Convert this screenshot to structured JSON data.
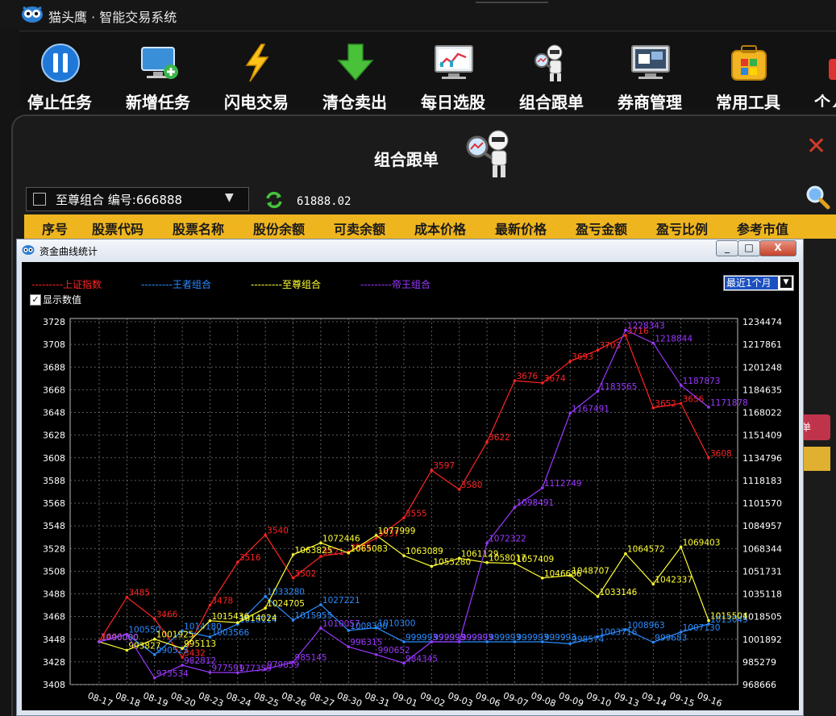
{
  "app": {
    "title": "猫头鹰 · 智能交易系统"
  },
  "toolbar": [
    {
      "label": "停止任务",
      "icon": "pause-icon"
    },
    {
      "label": "新增任务",
      "icon": "add-monitor-icon"
    },
    {
      "label": "闪电交易",
      "icon": "lightning-icon"
    },
    {
      "label": "清仓卖出",
      "icon": "download-arrow-icon"
    },
    {
      "label": "每日选股",
      "icon": "stock-chart-monitor-icon"
    },
    {
      "label": "组合跟单",
      "icon": "robot-magnifier-icon"
    },
    {
      "label": "券商管理",
      "icon": "broker-monitor-icon"
    },
    {
      "label": "常用工具",
      "icon": "toolbox-icon"
    },
    {
      "label": "个人",
      "icon": "user-icon"
    }
  ],
  "panel": {
    "title": "组合跟单",
    "portfolio_select": "至尊组合  编号:666888",
    "balance": "61888.02",
    "columns": [
      "序号",
      "股票代码",
      "股票名称",
      "股份余额",
      "可卖余额",
      "成本价格",
      "最新价格",
      "盈亏金额",
      "盈亏比例",
      "参考市值"
    ],
    "side_button_label": "单"
  },
  "dialog": {
    "title": "资金曲线统计",
    "minimize": "_",
    "maximize": "□",
    "close": "X",
    "period_select": "最近1个月",
    "show_values_label": "显示数值",
    "show_values_checked": true
  },
  "chart_data": {
    "type": "line",
    "categories": [
      "08-17",
      "08-18",
      "08-19",
      "08-20",
      "08-23",
      "08-24",
      "08-25",
      "08-26",
      "08-27",
      "08-30",
      "08-31",
      "09-01",
      "09-02",
      "09-03",
      "09-06",
      "09-07",
      "09-08",
      "09-09",
      "09-10",
      "09-13",
      "09-14",
      "09-15",
      "09-16"
    ],
    "left_ylim": [
      3408,
      3728
    ],
    "left_ticks": [
      3728,
      3708,
      3688,
      3668,
      3648,
      3628,
      3608,
      3588,
      3568,
      3548,
      3528,
      3508,
      3488,
      3468,
      3448,
      3428,
      3408
    ],
    "right_ylim": [
      968666,
      1234474
    ],
    "right_ticks": [
      1234474,
      1217861,
      1201248,
      1184635,
      1168022,
      1151409,
      1134796,
      1118183,
      1101570,
      1084957,
      1068344,
      1051731,
      1035118,
      1018505,
      1001892,
      985279,
      968666
    ],
    "grid": true,
    "series": [
      {
        "name": "上证指数",
        "axis": "left",
        "color": "#ff2424",
        "values": [
          3446,
          3485,
          3466,
          3432,
          3478,
          3516,
          3540,
          3502,
          3521,
          3525,
          3537,
          3555,
          3597,
          3580,
          3622,
          3676,
          3674,
          3693,
          3703,
          3716,
          3652,
          3656,
          3608
        ],
        "labels": [
          "3446",
          "3485",
          "3466",
          "3432",
          "3478",
          "3516",
          "3540",
          "3502",
          "3521",
          "3525",
          "3537",
          "3555",
          "3597",
          "3580",
          "3622",
          "3676",
          "3674",
          "3693",
          "3703",
          "3716",
          "3652",
          "3656",
          "3608"
        ]
      },
      {
        "name": "王者组合",
        "axis": "right",
        "color": "#2a8cff",
        "values": [
          1000000,
          1005504,
          990525,
          1008000,
          1003566,
          1013000,
          1033280,
          1015955,
          1027221,
          1008300,
          1010300,
          999993,
          999993,
          999993,
          999993,
          999993,
          999993,
          998574,
          1003716,
          1008963,
          999683,
          1007130,
          1013045
        ],
        "labels": [
          "1000000",
          "100550",
          "990525",
          "1014180",
          "1003566",
          "1018114",
          "1033280",
          "1015955",
          "1027221",
          "1008300",
          "1010300",
          "999993",
          "999993",
          "999993",
          "999993",
          "999993",
          "999993",
          "998574",
          "1003716",
          "1008963",
          "999683",
          "1007130",
          "1013045"
        ]
      },
      {
        "name": "至尊组合",
        "axis": "right",
        "color": "#ffff33",
        "values": [
          1000000,
          993827,
          1001925,
          995113,
          1015436,
          1014024,
          1024705,
          1063825,
          1072446,
          1065083,
          1077999,
          1063089,
          1055280,
          1061129,
          1058017,
          1057409,
          1046686,
          1048707,
          1033146,
          1064572,
          1042337,
          1069403,
          1015504
        ],
        "labels": [
          "1000000",
          "993827",
          "1001925",
          "995113",
          "1015436",
          "1014024",
          "1024705",
          "1063825",
          "1072446",
          "1065083",
          "1077999",
          "1063089",
          "1055280",
          "1061129",
          "1058017",
          "1057409",
          "1046686",
          "1048707",
          "1033146",
          "1064572",
          "1042337",
          "1069403",
          "1015504"
        ]
      },
      {
        "name": "帝王组合",
        "axis": "right",
        "color": "#9b38ff",
        "values": [
          1000000,
          1005500,
          973534,
          982812,
          977591,
          977359,
          979859,
          985145,
          1010057,
          996315,
          990652,
          984345,
          999993,
          999993,
          1072322,
          1098491,
          1112749,
          1167491,
          1183565,
          1228343,
          1218844,
          1187873,
          1171878
        ],
        "labels": [
          "1000000",
          "",
          "973534",
          "982812",
          "977591",
          "977359",
          "979859",
          "985145",
          "1010057",
          "996315",
          "990652",
          "984345",
          "999993",
          "999993",
          "1072322",
          "1098491",
          "1112749",
          "1167491",
          "1183565",
          "1228343",
          "1218844",
          "1187873",
          "1171878"
        ]
      }
    ]
  }
}
